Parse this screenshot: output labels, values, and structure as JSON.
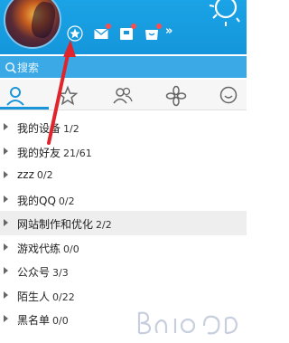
{
  "search": {
    "placeholder": "搜索"
  },
  "header": {
    "icons": [
      "qzone-star-icon",
      "mail-icon",
      "wallet-icon",
      "shop-icon"
    ],
    "more_label": "»"
  },
  "tabs": [
    "contacts-icon",
    "favorites-star-icon",
    "group-icon",
    "flower-icon",
    "chat-bubble-icon"
  ],
  "groups": [
    {
      "name": "我的设备",
      "count": "1/2"
    },
    {
      "name": "我的好友",
      "count": "21/61"
    },
    {
      "name": "zzz",
      "count": "0/2"
    },
    {
      "name": "我的QQ",
      "count": "0/2"
    },
    {
      "name": "网站制作和优化",
      "count": "2/2"
    },
    {
      "name": "游戏代练",
      "count": "0/0"
    },
    {
      "name": "公众号",
      "count": "3/3"
    },
    {
      "name": "陌生人",
      "count": "0/22"
    },
    {
      "name": "黑名单",
      "count": "0/0"
    }
  ],
  "colors": {
    "header": "#1596db",
    "annotation_arrow": "#e0242b"
  }
}
